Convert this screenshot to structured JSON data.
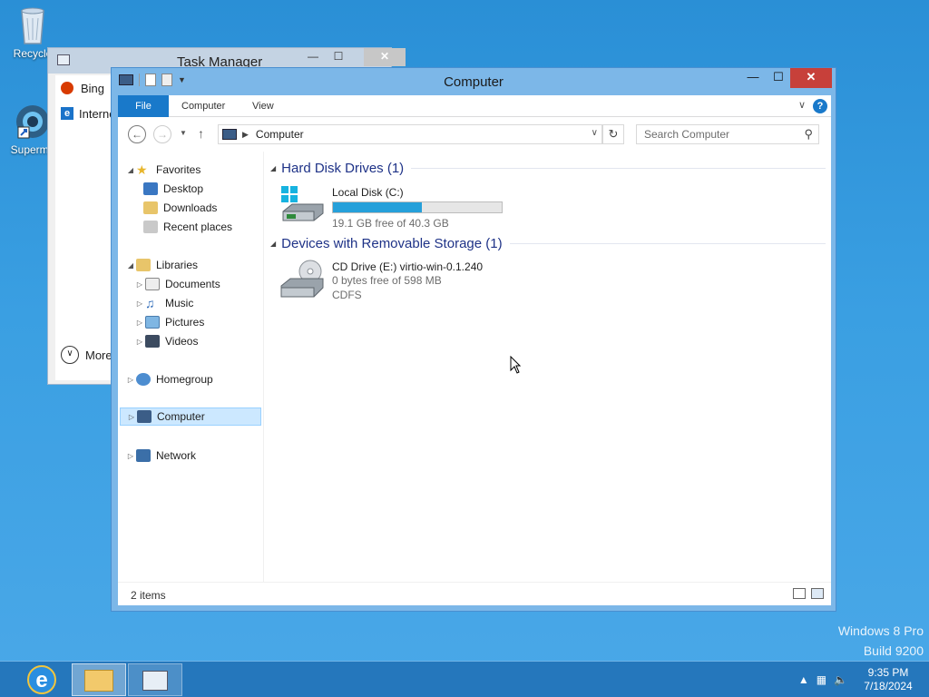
{
  "desktop": {
    "icons": [
      {
        "label": "Recycle",
        "icon": "recycle-bin-icon"
      },
      {
        "label": "Supermi",
        "icon": "supermium-browser-icon"
      }
    ],
    "watermark": {
      "line1": "Windows 8 Pro",
      "line2": "Build 9200"
    }
  },
  "task_manager": {
    "title": "Task Manager",
    "items": [
      {
        "label": "Bing",
        "icon": "bing-icon"
      },
      {
        "label": "Interne",
        "icon": "internet-explorer-icon"
      }
    ],
    "more_label": "More"
  },
  "explorer": {
    "title": "Computer",
    "ribbon_tabs": [
      "File",
      "Computer",
      "View"
    ],
    "address": {
      "location": "Computer"
    },
    "search": {
      "placeholder": "Search Computer"
    },
    "nav": {
      "favorites": "Favorites",
      "desktop": "Desktop",
      "downloads": "Downloads",
      "recent_places": "Recent places",
      "libraries": "Libraries",
      "documents": "Documents",
      "music": "Music",
      "pictures": "Pictures",
      "videos": "Videos",
      "homegroup": "Homegroup",
      "computer": "Computer",
      "network": "Network"
    },
    "groups": [
      {
        "title": "Hard Disk Drives (1)",
        "drives": [
          {
            "name": "Local Disk (C:)",
            "free_text": "19.1 GB free of 40.3 GB",
            "used_fraction": 0.526
          }
        ]
      },
      {
        "title": "Devices with Removable Storage (1)",
        "drives": [
          {
            "name": "CD Drive (E:) virtio-win-0.1.240",
            "free_text": "0 bytes free of 598 MB",
            "fs": "CDFS"
          }
        ]
      }
    ],
    "status": {
      "item_count": "2 items"
    }
  },
  "taskbar": {
    "clock": {
      "time": "9:35 PM",
      "date": "7/18/2024"
    }
  },
  "colors": {
    "accent": "#1979ca",
    "drive_bar": "#26a0da",
    "close": "#c7403a"
  }
}
